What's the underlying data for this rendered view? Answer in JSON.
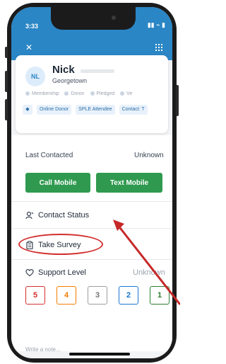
{
  "status_bar": {
    "time": "3:33",
    "signal": "▮▮ ⌁ ▮"
  },
  "header": {
    "close_icon": "close-icon",
    "menu_icon": "grid-icon"
  },
  "contact": {
    "initials": "NL",
    "name": "Nick",
    "city": "Georgetown",
    "statuses": [
      "Membership",
      "Donor",
      "Pledged",
      "Ve"
    ],
    "tags": [
      "Online Donor",
      "SPLE Attendee",
      "Contact: T"
    ]
  },
  "last_contacted": {
    "label": "Last Contacted",
    "value": "Unknown"
  },
  "actions": {
    "call": "Call Mobile",
    "text": "Text Mobile"
  },
  "contact_status": {
    "label": "Contact Status"
  },
  "survey": {
    "label": "Take Survey"
  },
  "support": {
    "label": "Support Level",
    "value": "Unknown",
    "levels": [
      {
        "value": "5",
        "color": "#d32f2f"
      },
      {
        "value": "4",
        "color": "#f57c00"
      },
      {
        "value": "3",
        "color": "#9e9e9e"
      },
      {
        "value": "2",
        "color": "#1976d2"
      },
      {
        "value": "1",
        "color": "#2e7d32"
      }
    ]
  },
  "note": {
    "placeholder": "Write a note..."
  },
  "colors": {
    "brand": "#2a86c5",
    "action": "#2f9a4f",
    "annotation": "#d32f2f"
  }
}
